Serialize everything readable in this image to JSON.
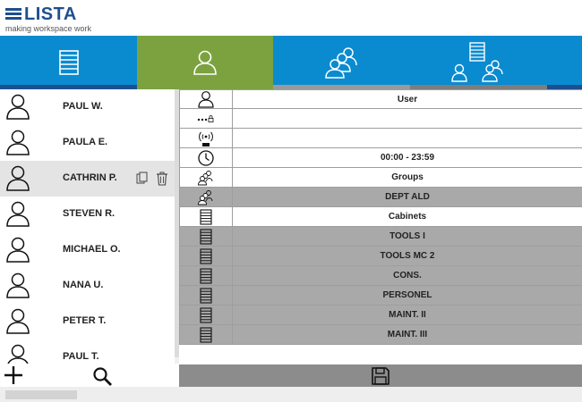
{
  "brand": {
    "name": "LISTA",
    "tagline": "making workspace work",
    "color": "#1d4f8f"
  },
  "tabs": [
    {
      "name": "cabinets",
      "icon": "cabinet-icon",
      "active": false
    },
    {
      "name": "user",
      "icon": "user-icon",
      "active": true
    },
    {
      "name": "groups",
      "icon": "groups-icon",
      "active": false
    },
    {
      "name": "access",
      "icon": "user-group-cabinet-icon",
      "active": false
    }
  ],
  "colors": {
    "tab_bar": "#0a8bd0",
    "active_tab": "#7ba23f",
    "row_gray": "#a9a9a9",
    "save_bar": "#8c8c8c"
  },
  "users": [
    {
      "name": "PAUL W."
    },
    {
      "name": "PAULA E."
    },
    {
      "name": "CATHRIN P.",
      "selected": true
    },
    {
      "name": "STEVEN R."
    },
    {
      "name": "MICHAEL O."
    },
    {
      "name": "NANA U."
    },
    {
      "name": "PETER T."
    },
    {
      "name": "PAUL T."
    }
  ],
  "detail": {
    "rows": [
      {
        "icon": "user-icon",
        "value": "User",
        "gray": false
      },
      {
        "icon": "password-icon",
        "value": "",
        "gray": false
      },
      {
        "icon": "rfid-icon",
        "value": "",
        "gray": false
      },
      {
        "icon": "clock-icon",
        "value": "00:00 - 23:59",
        "gray": false
      },
      {
        "icon": "groups-icon",
        "value": "Groups",
        "gray": false
      },
      {
        "icon": "groups-icon",
        "value": "DEPT ALD",
        "gray": true
      },
      {
        "icon": "cabinet-icon",
        "value": "Cabinets",
        "gray": false
      },
      {
        "icon": "cabinet-icon",
        "value": "TOOLS I",
        "gray": true
      },
      {
        "icon": "cabinet-icon",
        "value": "TOOLS MC 2",
        "gray": true
      },
      {
        "icon": "cabinet-icon",
        "value": "CONS.",
        "gray": true
      },
      {
        "icon": "cabinet-icon",
        "value": "PERSONEL",
        "gray": true
      },
      {
        "icon": "cabinet-icon",
        "value": "MAINT. II",
        "gray": true
      },
      {
        "icon": "cabinet-icon",
        "value": "MAINT. III",
        "gray": true
      }
    ]
  },
  "actions": {
    "add_icon": "plus-icon",
    "search_icon": "search-icon",
    "save_icon": "save-icon"
  }
}
